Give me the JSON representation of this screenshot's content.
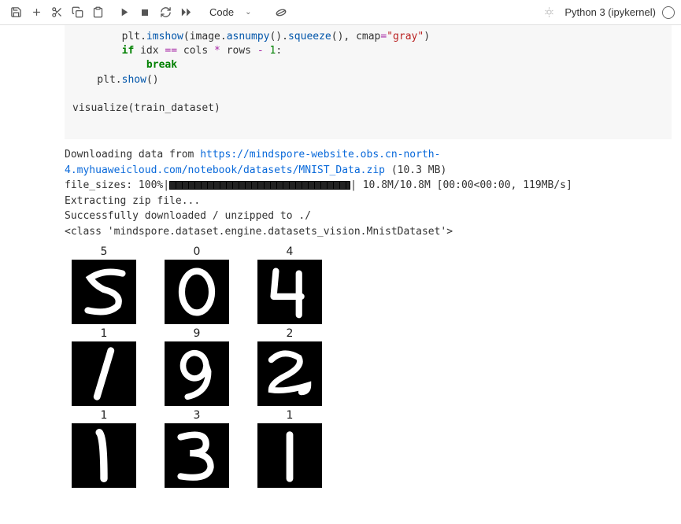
{
  "toolbar": {
    "cell_type": "Code",
    "kernel": "Python 3 (ipykernel)"
  },
  "code": {
    "line1_a": "        plt.",
    "line1_b": "imshow",
    "line1_c": "(image.",
    "line1_d": "asnumpy",
    "line1_e": "().",
    "line1_f": "squeeze",
    "line1_g": "(), cmap",
    "line1_h": "=",
    "line1_i": "\"gray\"",
    "line1_j": ")",
    "line2_a": "        ",
    "line2_b": "if",
    "line2_c": " idx ",
    "line2_d": "==",
    "line2_e": " cols ",
    "line2_f": "*",
    "line2_g": " rows ",
    "line2_h": "-",
    "line2_i": " ",
    "line2_j": "1",
    "line2_k": ":",
    "line3_a": "            ",
    "line3_b": "break",
    "line4_a": "    plt.",
    "line4_b": "show",
    "line4_c": "()",
    "line5": "",
    "line6": "visualize(train_dataset)"
  },
  "output": {
    "dl_prefix": "Downloading data from ",
    "dl_url": "https://mindspore-website.obs.cn-north-4.myhuaweicloud.com/notebook/datasets/MNIST_Data.zip",
    "dl_size": " (10.3 MB)",
    "blank": "",
    "progress_label": "file_sizes: 100%|",
    "progress_suffix": "| 10.8M/10.8M [00:00<00:00, 119MB/s]",
    "extract": "Extracting zip file...",
    "success": "Successfully downloaded / unzipped to ./",
    "class_repr": "<class 'mindspore.dataset.engine.datasets_vision.MnistDataset'>"
  },
  "chart_data": {
    "type": "image-grid",
    "rows": 3,
    "cols": 3,
    "cmap": "gray",
    "labels": [
      "5",
      "0",
      "4",
      "1",
      "9",
      "2",
      "1",
      "3",
      "1"
    ]
  }
}
